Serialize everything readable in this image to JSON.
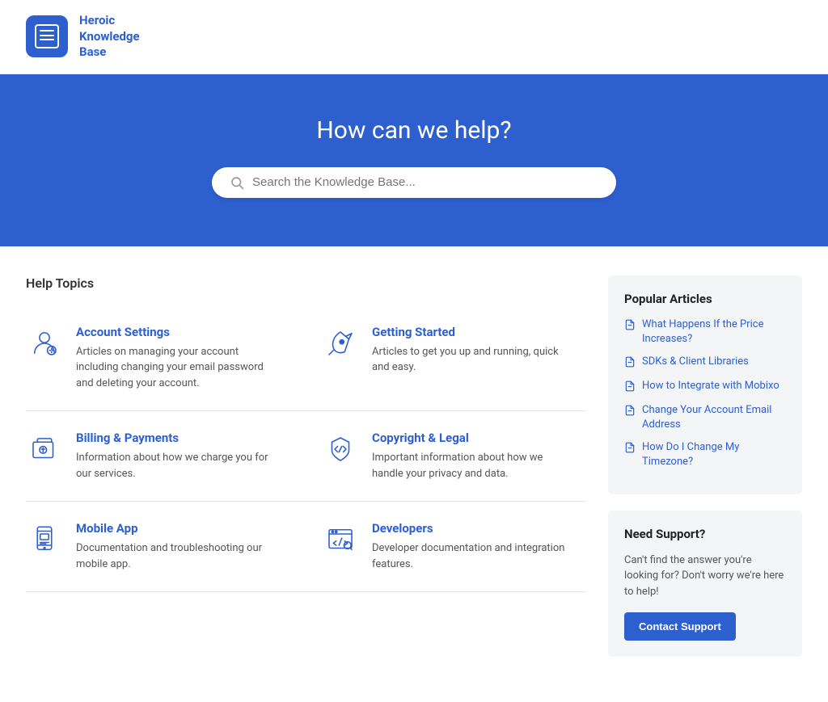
{
  "header": {
    "logo_alt": "Heroic Knowledge Base",
    "logo_line1": "Heroic",
    "logo_line2": "Knowledge",
    "logo_line3": "Base"
  },
  "hero": {
    "title": "How can we help?",
    "search_placeholder": "Search the Knowledge Base..."
  },
  "help_topics": {
    "section_title": "Help Topics",
    "topics": [
      {
        "id": "account-settings",
        "title": "Account Settings",
        "description": "Articles on managing your account including changing your email password and deleting your account.",
        "icon": "account"
      },
      {
        "id": "getting-started",
        "title": "Getting Started",
        "description": "Articles to get you up and running, quick and easy.",
        "icon": "rocket"
      },
      {
        "id": "billing-payments",
        "title": "Billing & Payments",
        "description": "Information about how we charge you for our services.",
        "icon": "billing"
      },
      {
        "id": "copyright-legal",
        "title": "Copyright & Legal",
        "description": "Important information about how we handle your privacy and data.",
        "icon": "legal"
      },
      {
        "id": "mobile-app",
        "title": "Mobile App",
        "description": "Documentation and troubleshooting our mobile app.",
        "icon": "mobile"
      },
      {
        "id": "developers",
        "title": "Developers",
        "description": "Developer documentation and integration features.",
        "icon": "developers"
      }
    ]
  },
  "sidebar": {
    "popular_articles": {
      "title": "Popular Articles",
      "articles": [
        {
          "text": "What Happens If the Price Increases?"
        },
        {
          "text": "SDKs & Client Libraries"
        },
        {
          "text": "How to Integrate with Mobixo"
        },
        {
          "text": "Change Your Account Email Address"
        },
        {
          "text": "How Do I Change My Timezone?"
        }
      ]
    },
    "need_support": {
      "title": "Need Support?",
      "description": "Can't find the answer you're looking for? Don't worry we're here to help!",
      "button_label": "Contact Support"
    }
  }
}
